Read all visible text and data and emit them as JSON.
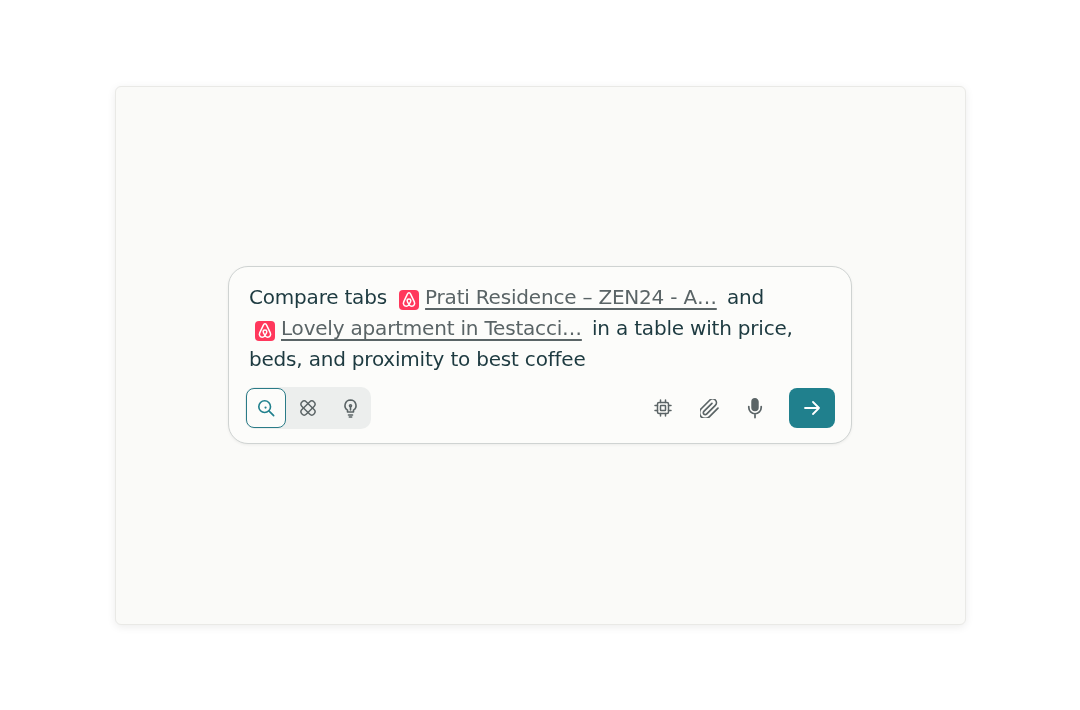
{
  "prompt": {
    "segments": [
      {
        "kind": "text",
        "text": "Compare tabs"
      },
      {
        "kind": "tab",
        "text": "Prati Residence – ZEN24 - A…"
      },
      {
        "kind": "text",
        "text": "and"
      },
      {
        "kind": "tab",
        "text": "Lovely apartment in Testacci…"
      },
      {
        "kind": "text",
        "text": "in a table with price, beds, and proximity to best coffee"
      }
    ]
  },
  "modes": [
    {
      "selected": true
    },
    {
      "selected": false
    },
    {
      "selected": false
    }
  ]
}
